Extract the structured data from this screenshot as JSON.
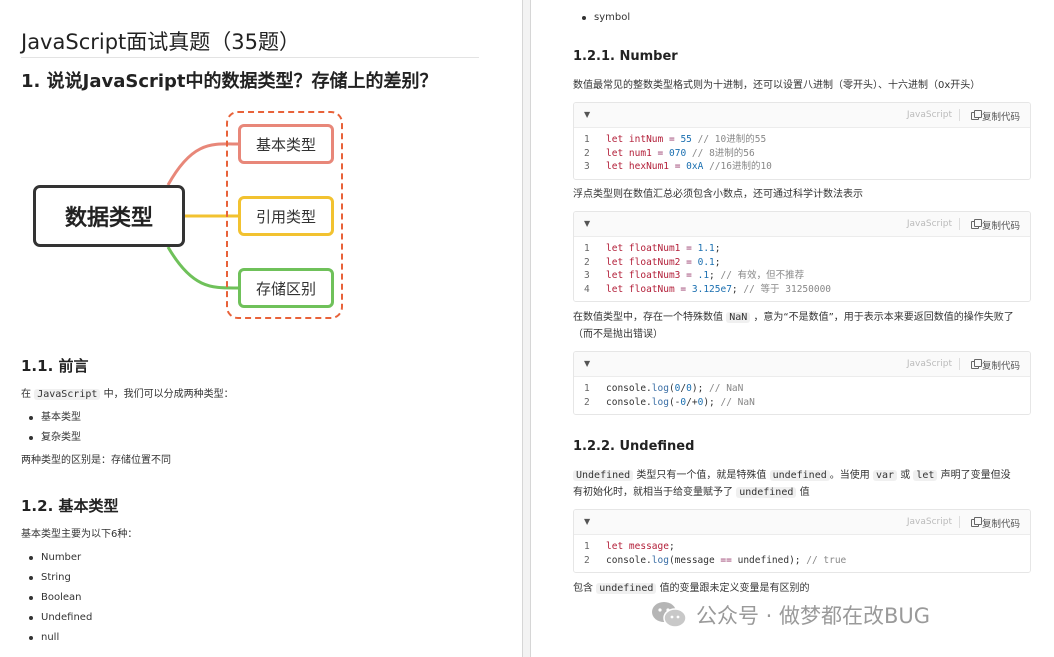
{
  "left": {
    "doc_title": "JavaScript面试真题（35题）",
    "h1": "1. 说说JavaScript中的数据类型？存储上的差别？",
    "mindmap": {
      "root": "数据类型",
      "nodes": [
        "基本类型",
        "引用类型",
        "存储区别"
      ],
      "colors": {
        "n1": "#e88779",
        "n2": "#f2c230",
        "n3": "#6fc15a",
        "group": "#e8623a"
      }
    },
    "sec_preface": {
      "title": "1.1. 前言",
      "para_before": "在",
      "para_code": "JavaScript",
      "para_after": "中，我们可以分成两种类型：",
      "items": [
        "基本类型",
        "复杂类型"
      ],
      "note": "两种类型的区别是：存储位置不同"
    },
    "sec_basic": {
      "title": "1.2. 基本类型",
      "intro": "基本类型主要为以下6种：",
      "items": [
        "Number",
        "String",
        "Boolean",
        "Undefined",
        "null"
      ]
    }
  },
  "right": {
    "top_item": "symbol",
    "sec_number": {
      "title": "1.2.1. Number",
      "intro": "数值最常见的整数类型格式则为十进制，还可以设置八进制（零开头）、十六进制（0x开头）",
      "float_intro": "浮点类型则在数值汇总必须包含小数点，还可通过科学计数法表示",
      "nan_before": "在数值类型中，存在一个特殊数值",
      "nan_code": "NaN",
      "nan_after": "，意为“不是数值”，用于表示本来要返回数值的操作失败了",
      "nan_line2": "（而不是抛出错误）"
    },
    "sec_undefined": {
      "title": "1.2.2. Undefined",
      "code1": "Undefined",
      "t1": "类型只有一个值，就是特殊值",
      "code2": "undefined",
      "t2": "。当使用",
      "code3": "var",
      "t3": "或",
      "code4": "let",
      "t4": "声明了变量但没",
      "line2": "有初始化时，就相当于给变量赋予了",
      "code5": "undefined",
      "t5": "值",
      "footer_before": "包含",
      "footer_code": "undefined",
      "footer_after": "值的变量跟未定义变量是有区别的"
    },
    "code_toolbar": {
      "lang": "JavaScript",
      "copy": "复制代码"
    },
    "watermark": "公众号 · 做梦都在改BUG"
  }
}
